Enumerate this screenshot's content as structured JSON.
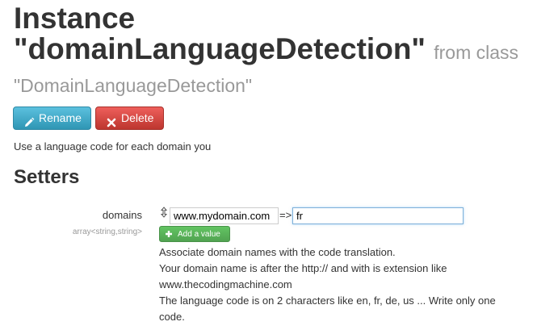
{
  "header": {
    "title_line1": "Instance",
    "title_line2": "\"domainLanguageDetection\"",
    "from_class": "from class",
    "class_name": "\"DomainLanguageDetection\""
  },
  "actions": {
    "rename_label": "Rename",
    "delete_label": "Delete"
  },
  "intro_text": "Use a language code for each domain you",
  "setters": {
    "heading": "Setters",
    "property": {
      "name": "domains",
      "type": "array<string,string>",
      "entries": [
        {
          "key": "www.mydomain.com",
          "separator": "=>",
          "value": "fr"
        }
      ],
      "add_value_label": "Add a value",
      "help_lines": [
        "Associate domain names with the code translation.",
        "Your domain name is after the http:// and with is extension like",
        "www.thecodingmachine.com",
        "The language code is on 2 characters like en, fr, de, us ... Write only one",
        "code."
      ]
    }
  },
  "colors": {
    "rename_button": "#49afcd",
    "delete_button": "#da4f49",
    "add_button": "#5bb75b",
    "muted_text": "#999999"
  },
  "icons": {
    "rename": "pencil-icon",
    "delete": "x-icon",
    "add": "plus-icon",
    "reorder": "vertical-resize-icon"
  }
}
